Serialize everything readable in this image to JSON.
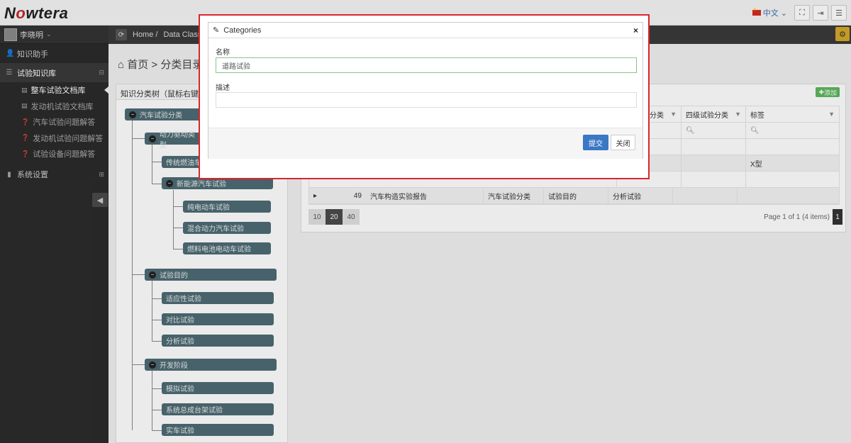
{
  "app": {
    "logo_pre": "N",
    "logo_accent": "o",
    "logo_post": "wtera",
    "language": "中文"
  },
  "sidebar": {
    "user_name": "李晓明",
    "items": [
      {
        "label": "知识助手"
      },
      {
        "label": "试验知识库"
      },
      {
        "label": "系统设置"
      }
    ],
    "sub_items": [
      {
        "label": "整车试验文档库"
      },
      {
        "label": "发动机试验文档库"
      },
      {
        "label": "汽车试验问题解答"
      },
      {
        "label": "发动机试验问题解答"
      },
      {
        "label": "试验设备问题解答"
      }
    ]
  },
  "breadcrumb": {
    "home": "Home /",
    "current": "Data Classific"
  },
  "page_title": "首页 > 分类目录查i",
  "tree": {
    "header": "知识分类树（鼠标右键点",
    "nodes": {
      "root": "汽车试验分类",
      "g1": "动力驱动类型",
      "g1a": "传统燃油车",
      "g1b": "新能源汽车试验",
      "g1b1": "纯电动车试验",
      "g1b2": "混合动力汽车试验",
      "g1b3": "燃料电池电动车试验",
      "g2": "试验目的",
      "g2a": "适应性试验",
      "g2b": "对比试验",
      "g2c": "分析试验",
      "g3": "开发阶段",
      "g3a": "模拟试验",
      "g3b": "系统总成台架试验",
      "g3c": "实车试验"
    }
  },
  "grid": {
    "add_label": "添加",
    "headers": [
      "三级试验分类",
      "四级试验分类",
      "标签"
    ],
    "rows": [
      {
        "tag": "X型"
      },
      {
        "id": "49",
        "title": "汽车构造实验报告",
        "c1": "汽车试验分类",
        "c2": "试验目的",
        "c3": "分析试验"
      }
    ],
    "page_sizes": [
      "10",
      "20",
      "40"
    ],
    "page_info": "Page 1 of 1 (4 items)",
    "page_num": "1"
  },
  "modal": {
    "title": "Categories",
    "name_label": "名称",
    "name_value": "道路试验",
    "desc_label": "描述",
    "desc_value": "",
    "submit": "提交",
    "close": "关闭"
  }
}
